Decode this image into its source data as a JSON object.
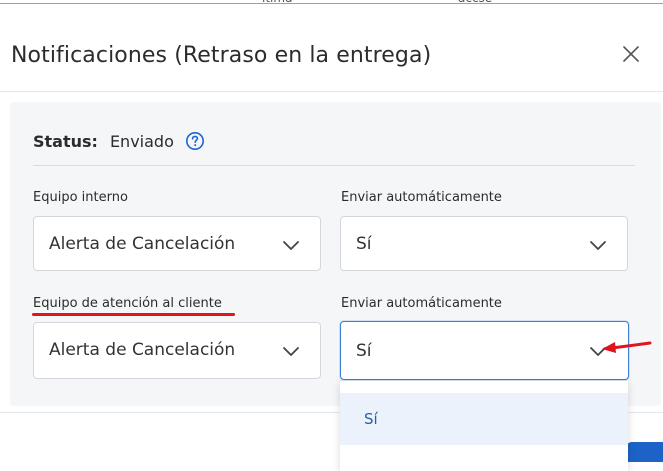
{
  "background_fragments": [
    "ltima",
    "accse"
  ],
  "modal": {
    "title": "Notificaciones (Retraso en la entrega)",
    "close_icon": "close-icon"
  },
  "status": {
    "label": "Status:",
    "value": "Enviado",
    "help_icon": "help-circle-icon"
  },
  "rows": [
    {
      "team_label": "Equipo interno",
      "team_value": "Alerta de Cancelación",
      "auto_label": "Enviar automáticamente",
      "auto_value": "Sí"
    },
    {
      "team_label": "Equipo de atención al cliente",
      "team_value": "Alerta de Cancelación",
      "auto_label": "Enviar automáticamente",
      "auto_value": "Sí"
    }
  ],
  "dropdown": {
    "options": [
      "Sí"
    ]
  },
  "colors": {
    "accent": "#3d7fd6",
    "annotation_red": "#e0141e",
    "panel_bg": "#f4f6f8",
    "option_highlight": "#ebf2fc",
    "primary_button": "#1d63c7"
  }
}
